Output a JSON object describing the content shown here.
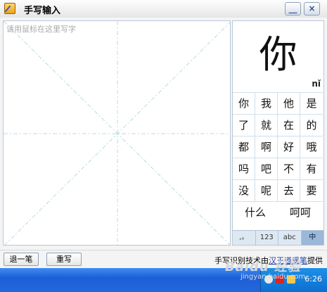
{
  "window": {
    "title": "手写输入",
    "minimize_glyph": "__",
    "close_glyph": "×"
  },
  "canvas": {
    "hint": "请用鼠标在这里写字",
    "guide_color": "#b7dce0"
  },
  "candidates": {
    "main_char": "你",
    "pinyin": "nǐ",
    "chars": [
      [
        "你",
        "我",
        "他",
        "是"
      ],
      [
        "了",
        "就",
        "在",
        "的"
      ],
      [
        "都",
        "啊",
        "好",
        "哦"
      ],
      [
        "吗",
        "吧",
        "不",
        "有"
      ],
      [
        "没",
        "呢",
        "去",
        "要"
      ]
    ],
    "words": [
      "什么",
      "呵呵"
    ],
    "modes": [
      ",。",
      "123",
      "abc",
      "中"
    ],
    "active_mode": "中"
  },
  "bottom": {
    "undo_label": "退一笔",
    "rewrite_label": "重写",
    "credit_prefix": "手写识别技术由",
    "credit_link": "汉王道遥笔",
    "credit_suffix": "提供"
  },
  "taskbar": {
    "clock": "6:26",
    "watermark": "Baidu 经验",
    "watermark_sub": "jingyan.baidu.com"
  }
}
